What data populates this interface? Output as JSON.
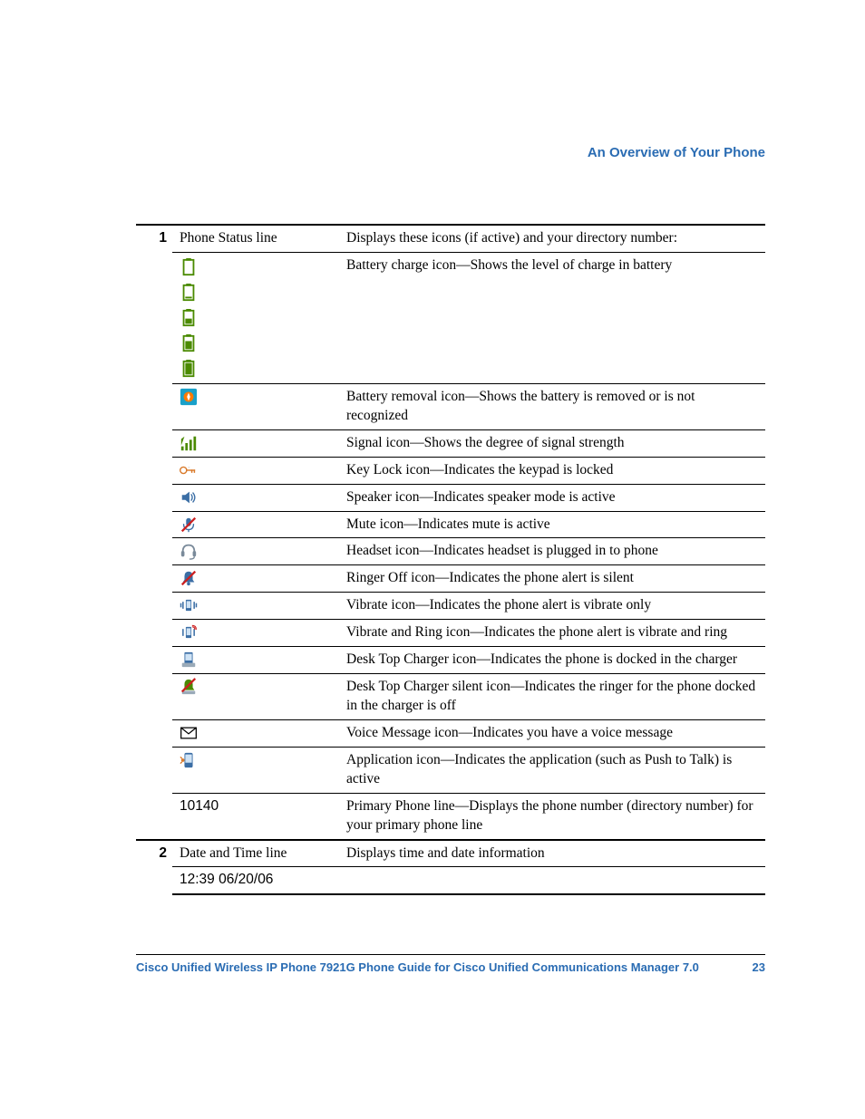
{
  "header": "An Overview of Your Phone",
  "footer": {
    "title": "Cisco Unified Wireless IP Phone 7921G Phone Guide for Cisco Unified Communications Manager 7.0",
    "page": "23"
  },
  "rows": [
    {
      "num": "1",
      "label": "Phone Status line",
      "desc": "Displays these icons (if active) and your directory number:",
      "icon": ""
    },
    {
      "num": "",
      "label": "",
      "desc": "Battery charge icon—Shows the level of charge in battery",
      "icon": "battery-stack"
    },
    {
      "num": "",
      "label": "",
      "desc": "Battery removal icon—Shows the battery is removed or is not recognized",
      "icon": "battery-removal"
    },
    {
      "num": "",
      "label": "",
      "desc": "Signal icon—Shows the degree of signal strength",
      "icon": "signal"
    },
    {
      "num": "",
      "label": "",
      "desc": "Key Lock icon—Indicates the keypad is locked",
      "icon": "key-lock"
    },
    {
      "num": "",
      "label": "",
      "desc": "Speaker icon—Indicates speaker mode is active",
      "icon": "speaker"
    },
    {
      "num": "",
      "label": "",
      "desc": "Mute icon—Indicates mute is active",
      "icon": "mute"
    },
    {
      "num": "",
      "label": "",
      "desc": "Headset icon—Indicates headset is plugged in to phone",
      "icon": "headset"
    },
    {
      "num": "",
      "label": "",
      "desc": "Ringer Off icon—Indicates the phone alert is silent",
      "icon": "ringer-off"
    },
    {
      "num": "",
      "label": "",
      "desc": "Vibrate icon—Indicates the phone alert is vibrate only",
      "icon": "vibrate"
    },
    {
      "num": "",
      "label": "",
      "desc": "Vibrate and Ring icon—Indicates the phone alert is vibrate and ring",
      "icon": "vibrate-ring"
    },
    {
      "num": "",
      "label": "",
      "desc": "Desk Top Charger icon—Indicates the phone is docked in the charger",
      "icon": "charger"
    },
    {
      "num": "",
      "label": "",
      "desc": "Desk Top Charger silent icon—Indicates the ringer for the phone docked in the charger is off",
      "icon": "charger-silent"
    },
    {
      "num": "",
      "label": "",
      "desc": "Voice Message icon—Indicates you have a voice message",
      "icon": "voicemail"
    },
    {
      "num": "",
      "label": "",
      "desc": "Application icon—Indicates the application (such as Push to Talk) is active",
      "icon": "application"
    },
    {
      "num": "",
      "label": "10140",
      "desc": "Primary Phone line—Displays the phone number (directory number) for your primary phone line",
      "icon": "text"
    },
    {
      "num": "2",
      "label": "Date and Time line",
      "desc": "Displays time and date information",
      "icon": ""
    },
    {
      "num": "",
      "label": "12:39 06/20/06",
      "desc": "",
      "icon": "text"
    }
  ]
}
